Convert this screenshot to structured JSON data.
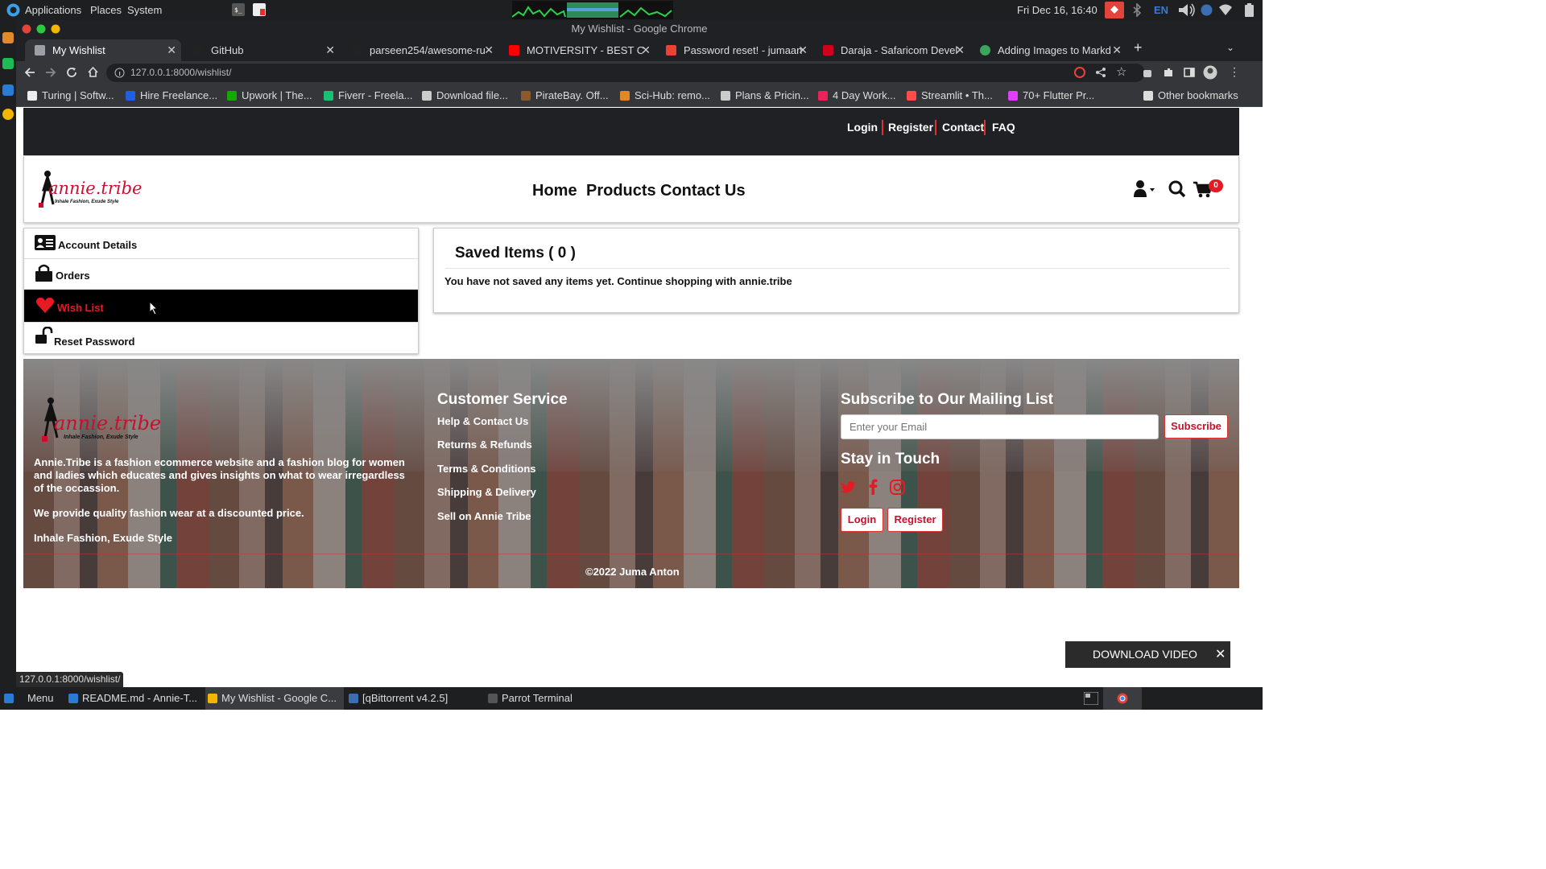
{
  "os": {
    "menu": [
      "Applications",
      "Places",
      "System"
    ],
    "clock": "Fri Dec 16, 16:40",
    "lang": "EN"
  },
  "window": {
    "title": "My Wishlist - Google Chrome"
  },
  "tabs": [
    {
      "label": "My Wishlist",
      "favicon_color": "#9aa0a6"
    },
    {
      "label": "GitHub",
      "favicon_color": "#222222"
    },
    {
      "label": "parseen254/awesome-ru",
      "favicon_color": "#222222"
    },
    {
      "label": "MOTIVERSITY - BEST C",
      "favicon_color": "#ff0000"
    },
    {
      "label": "Password reset! - jumaan",
      "favicon_color": "#ea4335"
    },
    {
      "label": "Daraja - Safaricom Devel",
      "favicon_color": "#d0021b"
    },
    {
      "label": "Adding Images to Markd",
      "favicon_color": "#3ba55c"
    }
  ],
  "address": {
    "url": "127.0.0.1:8000/wishlist/"
  },
  "bookmarks": [
    {
      "label": "Turing | Softw...",
      "color": "#eeeeee"
    },
    {
      "label": "Hire Freelance...",
      "color": "#1f5fe0"
    },
    {
      "label": "Upwork | The...",
      "color": "#14a800"
    },
    {
      "label": "Fiverr - Freela...",
      "color": "#1dbf73"
    },
    {
      "label": "Download file...",
      "color": "#cccccc"
    },
    {
      "label": "PirateBay. Off...",
      "color": "#8b5a2b"
    },
    {
      "label": "Sci-Hub: remo...",
      "color": "#e0872a"
    },
    {
      "label": "Plans & Pricin...",
      "color": "#cccccc"
    },
    {
      "label": "4 Day Work...",
      "color": "#e8245a"
    },
    {
      "label": "Streamlit • Th...",
      "color": "#ff4b4b"
    },
    {
      "label": "70+ Flutter Pr...",
      "color": "#e040fb"
    }
  ],
  "other_bookmarks": "Other bookmarks",
  "site": {
    "top_links": [
      "Login",
      "Register",
      "Contact",
      "FAQ"
    ],
    "logo_text": "annie.tribe",
    "logo_tagline": "Inhale Fashion, Exude Style",
    "nav": [
      "Home",
      "Products",
      "Contact Us"
    ],
    "cart_count": "0",
    "accent": "#e51b23"
  },
  "account_menu": [
    {
      "label": "Account Details",
      "icon": "id-card-icon"
    },
    {
      "label": "Orders",
      "icon": "shopping-bag-icon"
    },
    {
      "label": "Wish List",
      "icon": "heart-icon",
      "active": true
    },
    {
      "label": "Reset Password",
      "icon": "unlock-icon"
    }
  ],
  "saved": {
    "title": "Saved Items ( 0 )",
    "message": "You have not saved any items yet. Continue shopping with annie.tribe"
  },
  "footer": {
    "about1": "Annie.Tribe is a fashion ecommerce website and a fashion blog for women and ladies which educates and gives insights on what to wear irregardless of the occassion.",
    "about2": "We provide quality fashion wear at a discounted price.",
    "about3": "Inhale Fashion, Exude Style",
    "cs_title": "Customer Service",
    "cs_links": [
      "Help & Contact Us",
      "Returns & Refunds",
      "Terms & Conditions",
      "Shipping & Delivery",
      "Sell on Annie Tribe"
    ],
    "mail_title": "Subscribe to Our Mailing List",
    "email_placeholder": "Enter your Email",
    "subscribe": "Subscribe",
    "touch_title": "Stay in Touch",
    "login": "Login",
    "register": "Register",
    "copyright": "©2022 Juma Anton"
  },
  "download_popup": "DOWNLOAD VIDEO",
  "status_url": "127.0.0.1:8000/wishlist/",
  "taskbar": [
    {
      "label": "Menu",
      "color": "#2a7bd6"
    },
    {
      "label": "README.md - Annie-T...",
      "color": "#2a7bd6"
    },
    {
      "label": "My Wishlist - Google C...",
      "color": "#f2b600",
      "active": true
    },
    {
      "label": "[qBittorrent v4.2.5]",
      "color": "#3c6eb4"
    },
    {
      "label": "Parrot Terminal",
      "color": "#555555"
    }
  ]
}
